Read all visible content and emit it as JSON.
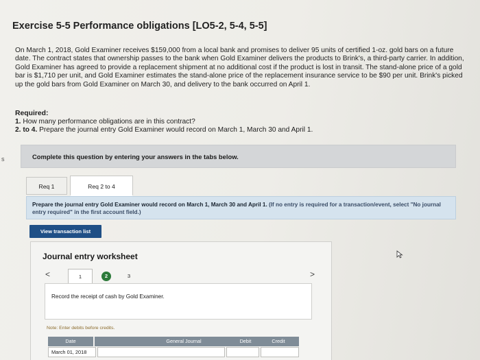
{
  "title": "Exercise 5-5 Performance obligations [LO5-2, 5-4, 5-5]",
  "problem_text": "On March 1, 2018, Gold Examiner receives $159,000 from a local bank and promises to deliver 95 units of certified 1-oz. gold bars on a future date. The contract states that ownership passes to the bank when Gold Examiner delivers the products to Brink's, a third-party carrier. In addition, Gold Examiner has agreed to provide a replacement shipment at no additional cost if the product is lost in transit. The stand-alone price of a gold bar is $1,710 per unit, and Gold Examiner estimates the stand-alone price of the replacement insurance service to be $90 per unit. Brink's picked up the gold bars from Gold Examiner on March 30, and delivery to the bank occurred on April 1.",
  "required": {
    "heading": "Required:",
    "items": [
      {
        "num": "1.",
        "text": " How many performance obligations are in this contract?"
      },
      {
        "num": "2. to 4.",
        "text": " Prepare the journal entry Gold Examiner would record on March 1, March 30 and April 1."
      }
    ]
  },
  "side_mark": "s",
  "instruction": "Complete this question by entering your answers in the tabs below.",
  "tabs": [
    {
      "label": "Req 1"
    },
    {
      "label": "Req 2 to 4"
    }
  ],
  "prep": {
    "text": "Prepare the journal entry Gold Examiner would record on March 1, March 30 and April 1. ",
    "note": "(If no entry is required for a transaction/event, select \"No journal entry required\" in the first account field.)"
  },
  "view_button": "View transaction list",
  "worksheet": {
    "title": "Journal entry worksheet",
    "prev": "<",
    "next": ">",
    "steps": [
      "1",
      "2",
      "3"
    ],
    "record_text": "Record the receipt of cash by Gold Examiner.",
    "note": "Note: Enter debits before credits.",
    "columns": {
      "date": "Date",
      "journal": "General Journal",
      "debit": "Debit",
      "credit": "Credit"
    },
    "row_date": "March 01, 2018"
  }
}
